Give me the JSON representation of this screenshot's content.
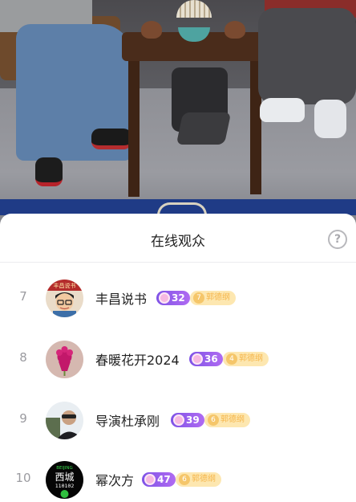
{
  "sheet": {
    "title": "在线观众",
    "help_icon": "question-icon",
    "help_symbol": "?"
  },
  "viewers": [
    {
      "rank": "7",
      "name": "丰昌说书",
      "level": "32",
      "fan_level": "7",
      "fan_club": "郭德纲"
    },
    {
      "rank": "8",
      "name": "春暖花开2024",
      "level": "36",
      "fan_level": "4",
      "fan_club": "郭德纲"
    },
    {
      "rank": "9",
      "name": "导演杜承刚",
      "level": "39",
      "fan_level": "6",
      "fan_club": "郭德纲"
    },
    {
      "rank": "10",
      "name": "幂次方",
      "level": "47",
      "fan_level": "6",
      "fan_club": "郭德纲"
    }
  ],
  "avatar_texts": {
    "a7_banner": "丰昌说书",
    "a10_line1": "BEIJING",
    "a10_line2": "西城",
    "a10_line3": "110102"
  },
  "colors": {
    "level_badge": "#8a5ae8",
    "fan_badge": "#fde7b0",
    "rug": "#1f3b86"
  }
}
